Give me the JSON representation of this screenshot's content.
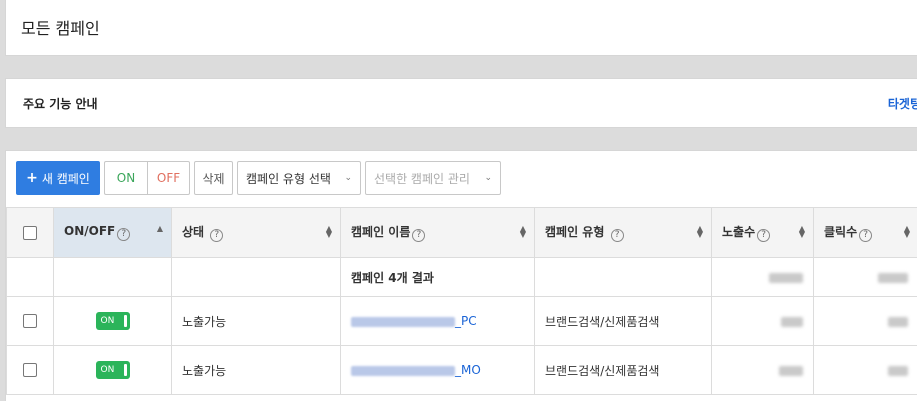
{
  "page": {
    "title": "모든 캠페인"
  },
  "info": {
    "title": "주요 기능 안내",
    "link": "타겟팅"
  },
  "toolbar": {
    "new_campaign": "새 캠페인",
    "on": "ON",
    "off": "OFF",
    "delete": "삭제",
    "type_select": "캠페인 유형 선택",
    "manage_selected": "선택한 캠페인 관리"
  },
  "table": {
    "columns": [
      "ON/OFF",
      "상태",
      "캠페인 이름",
      "캠페인 유형",
      "노출수",
      "클릭수"
    ],
    "summary": "캠페인 4개 결과",
    "rows": [
      {
        "toggle": "ON",
        "status": "노출가능",
        "name_suffix": "_PC",
        "type": "브랜드검색/신제품검색"
      },
      {
        "toggle": "ON",
        "status": "노출가능",
        "name_suffix": "_MO",
        "type": "브랜드검색/신제품검색"
      }
    ]
  },
  "colors": {
    "accent": "#2f7de1",
    "on_green": "#2bb45a",
    "link": "#1a64d6"
  },
  "icons": [
    "plus-icon",
    "chevron-down-icon",
    "help-icon",
    "sort-icon"
  ]
}
